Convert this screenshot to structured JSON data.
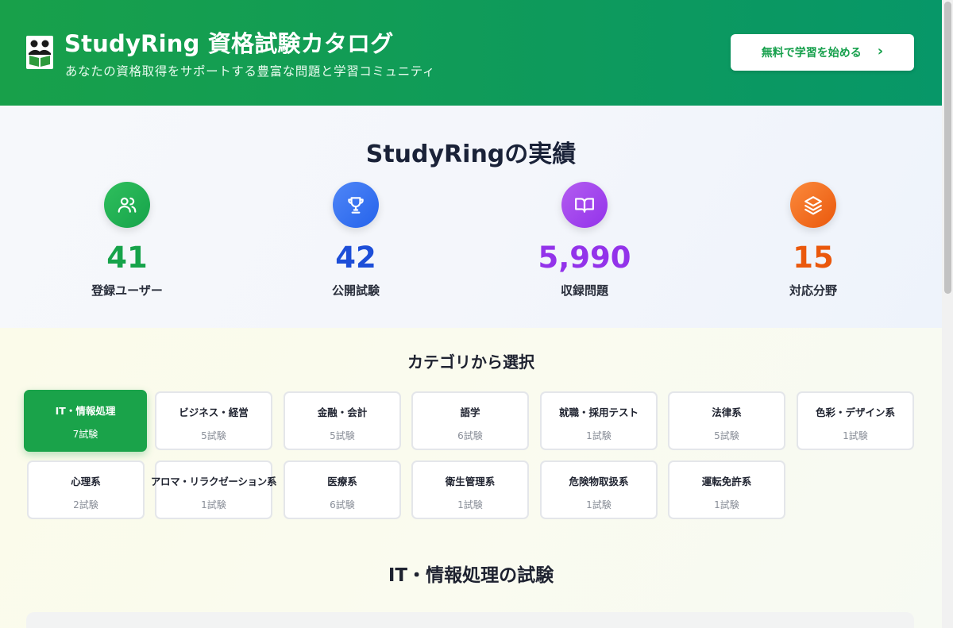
{
  "header": {
    "title": "StudyRing 資格試験カタログ",
    "subtitle": "あなたの資格取得をサポートする豊富な問題と学習コミュニティ",
    "cta_label": "無料で学習を始める",
    "cta_icon": "chevron-right-icon",
    "logo_icon": "people-book-logo"
  },
  "stats": {
    "title": "StudyRingの実績",
    "items": [
      {
        "value": "41",
        "label": "登録ユーザー",
        "icon": "users-icon",
        "color": "#16a34a"
      },
      {
        "value": "42",
        "label": "公開試験",
        "icon": "trophy-icon",
        "color": "#1d4ed8"
      },
      {
        "value": "5,990",
        "label": "収録問題",
        "icon": "book-open-icon",
        "color": "#9333ea"
      },
      {
        "value": "15",
        "label": "対応分野",
        "icon": "layers-icon",
        "color": "#ea580c"
      }
    ]
  },
  "categories": {
    "title": "カテゴリから選択",
    "items": [
      {
        "name": "IT・情報処理",
        "count": "7試験",
        "active": true
      },
      {
        "name": "ビジネス・経営",
        "count": "5試験"
      },
      {
        "name": "金融・会計",
        "count": "5試験"
      },
      {
        "name": "語学",
        "count": "6試験"
      },
      {
        "name": "就職・採用テスト",
        "count": "1試験"
      },
      {
        "name": "法律系",
        "count": "5試験"
      },
      {
        "name": "色彩・デザイン系",
        "count": "1試験"
      },
      {
        "name": "心理系",
        "count": "2試験"
      },
      {
        "name": "アロマ・リラクゼーション系",
        "count": "1試験"
      },
      {
        "name": "医療系",
        "count": "6試験"
      },
      {
        "name": "衛生管理系",
        "count": "1試験"
      },
      {
        "name": "危険物取扱系",
        "count": "1試験"
      },
      {
        "name": "運転免許系",
        "count": "1試験"
      }
    ]
  },
  "exams": {
    "title": "IT・情報処理の試験"
  },
  "colors": {
    "brand": "#16a34a",
    "active_category": "#1aa34a"
  }
}
